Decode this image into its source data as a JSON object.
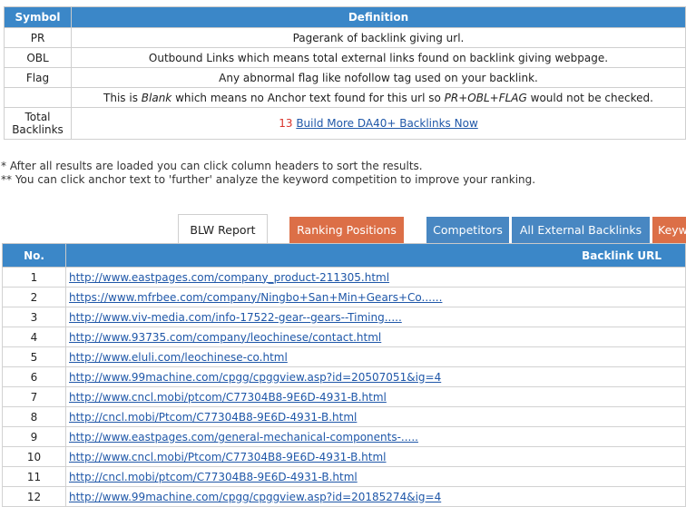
{
  "legend": {
    "headers": {
      "symbol": "Symbol",
      "definition": "Definition"
    },
    "rows": [
      {
        "symbol": "PR",
        "definition": "Pagerank of backlink giving url."
      },
      {
        "symbol": "OBL",
        "definition": "Outbound Links which means total external links found on backlink giving webpage."
      },
      {
        "symbol": "Flag",
        "definition": "Any abnormal flag like nofollow tag used on your backlink."
      }
    ],
    "blank_row": {
      "prefix": "This is ",
      "blank": "Blank",
      "middle": " which means no Anchor text found for this url so ",
      "emph": "PR+OBL+FLAG",
      "suffix": " would not be checked."
    },
    "total": {
      "label_line1": "Total",
      "label_line2": "Backlinks",
      "count": "13",
      "link": "Build More DA40+ Backlinks Now"
    }
  },
  "notes": [
    "* After all results are loaded you can click column headers to sort the results.",
    "** You can click anchor text to 'further' analyze the keyword competition to improve your ranking."
  ],
  "tabs": {
    "blw_report": "BLW Report",
    "ranking_positions": "Ranking Positions",
    "competitors": "Competitors",
    "all_external": "All External Backlinks",
    "keyword": "Keyw"
  },
  "results": {
    "headers": {
      "no": "No.",
      "url": "Backlink URL"
    },
    "rows": [
      {
        "no": "1",
        "url": "http://www.eastpages.com/company_product-211305.html"
      },
      {
        "no": "2",
        "url": "https://www.mfrbee.com/company/Ningbo+San+Min+Gears+Co......"
      },
      {
        "no": "3",
        "url": "http://www.viv-media.com/info-17522-gear--gears--Timing....."
      },
      {
        "no": "4",
        "url": "http://www.93735.com/company/leochinese/contact.html"
      },
      {
        "no": "5",
        "url": "http://www.eluli.com/leochinese-co.html"
      },
      {
        "no": "6",
        "url": "http://www.99machine.com/cpgg/cpggview.asp?id=20507051&ig=4"
      },
      {
        "no": "7",
        "url": "http://www.cncl.mobi/ptcom/C77304B8-9E6D-4931-B.html"
      },
      {
        "no": "8",
        "url": "http://cncl.mobi/Ptcom/C77304B8-9E6D-4931-B.html"
      },
      {
        "no": "9",
        "url": "http://www.eastpages.com/general-mechanical-components-....."
      },
      {
        "no": "10",
        "url": "http://www.cncl.mobi/Ptcom/C77304B8-9E6D-4931-B.html"
      },
      {
        "no": "11",
        "url": "http://cncl.mobi/ptcom/C77304B8-9E6D-4931-B.html"
      },
      {
        "no": "12",
        "url": "http://www.99machine.com/cpgg/cpggview.asp?id=20185274&ig=4"
      }
    ]
  }
}
